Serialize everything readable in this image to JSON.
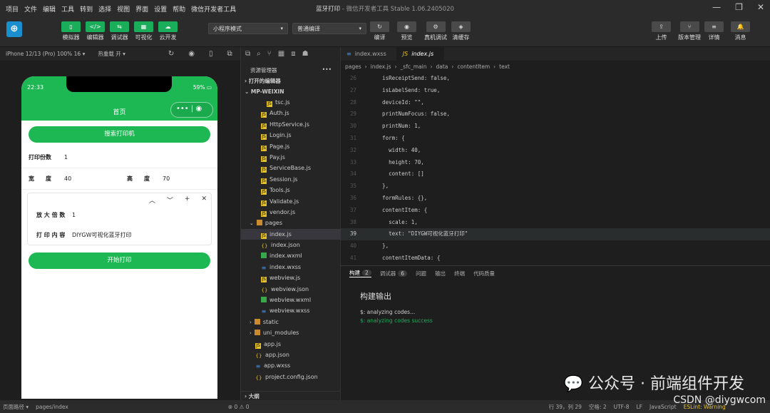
{
  "window": {
    "title": "蓝牙打印",
    "subtitle": "- 微信开发者工具 Stable 1.06.2405020",
    "menu": [
      "项目",
      "文件",
      "编辑",
      "工具",
      "转到",
      "选择",
      "视图",
      "界面",
      "设置",
      "帮助",
      "微信开发者工具"
    ]
  },
  "toolbar": {
    "left": [
      {
        "label": "模拟器",
        "glyph": "▯"
      },
      {
        "label": "编辑器",
        "glyph": "</>"
      },
      {
        "label": "调试器",
        "glyph": "⇆"
      },
      {
        "label": "可视化",
        "glyph": "▦"
      },
      {
        "label": "云开发",
        "glyph": "☁"
      }
    ],
    "mode": "小程序模式",
    "compile": "普通编译",
    "mid": [
      {
        "label": "编译",
        "glyph": "↻"
      },
      {
        "label": "预览",
        "glyph": "◉"
      },
      {
        "label": "真机调试",
        "glyph": "⚙"
      },
      {
        "label": "清缓存",
        "glyph": "◈"
      }
    ],
    "right": [
      {
        "label": "上传",
        "glyph": "⇪"
      },
      {
        "label": "版本管理",
        "glyph": "⑂"
      },
      {
        "label": "详情",
        "glyph": "≡"
      },
      {
        "label": "消息",
        "glyph": "🔔"
      }
    ]
  },
  "simbar": {
    "device": "iPhone 12/13 (Pro) 100% 16 ▾",
    "reload": "热重载 开 ▾"
  },
  "phone": {
    "time": "22:33",
    "battery": "59%",
    "title": "首页",
    "search_btn": "搜索打印机",
    "copies_label": "打印份数",
    "copies_value": "1",
    "width_label": "宽　　度",
    "width_value": "40",
    "height_label": "高　　度",
    "height_value": "70",
    "scale_label": "放 大 倍 数",
    "scale_value": "1",
    "content_label": "打 印 内 容",
    "content_value": "DIYGW可视化蓝牙打印",
    "start_btn": "开始打印"
  },
  "explorer": {
    "header": "资源管理器",
    "open_editors": "打开的编辑器",
    "project": "MP-WEIXIN",
    "outline": "大纲",
    "files": [
      {
        "name": "tsc.js",
        "type": "js",
        "indent": 36
      },
      {
        "name": "Auth.js",
        "type": "js",
        "indent": 28
      },
      {
        "name": "HttpService.js",
        "type": "js",
        "indent": 28
      },
      {
        "name": "Login.js",
        "type": "js",
        "indent": 28
      },
      {
        "name": "Page.js",
        "type": "js",
        "indent": 28
      },
      {
        "name": "Pay.js",
        "type": "js",
        "indent": 28
      },
      {
        "name": "ServiceBase.js",
        "type": "js",
        "indent": 28
      },
      {
        "name": "Session.js",
        "type": "js",
        "indent": 28
      },
      {
        "name": "Tools.js",
        "type": "js",
        "indent": 28
      },
      {
        "name": "Validate.js",
        "type": "js",
        "indent": 28
      },
      {
        "name": "vendor.js",
        "type": "js",
        "indent": 28
      },
      {
        "name": "pages",
        "type": "dir",
        "indent": 12
      },
      {
        "name": "index.js",
        "type": "js",
        "indent": 28,
        "active": true
      },
      {
        "name": "index.json",
        "type": "json",
        "indent": 28
      },
      {
        "name": "index.wxml",
        "type": "wxml",
        "indent": 28
      },
      {
        "name": "index.wxss",
        "type": "wxss",
        "indent": 28
      },
      {
        "name": "webview.js",
        "type": "js",
        "indent": 28
      },
      {
        "name": "webview.json",
        "type": "json",
        "indent": 28
      },
      {
        "name": "webview.wxml",
        "type": "wxml",
        "indent": 28
      },
      {
        "name": "webview.wxss",
        "type": "wxss",
        "indent": 28
      },
      {
        "name": "static",
        "type": "dir",
        "indent": 12
      },
      {
        "name": "uni_modules",
        "type": "dir",
        "indent": 12
      },
      {
        "name": "app.js",
        "type": "js",
        "indent": 20
      },
      {
        "name": "app.json",
        "type": "json",
        "indent": 20
      },
      {
        "name": "app.wxss",
        "type": "wxss",
        "indent": 20
      },
      {
        "name": "project.config.json",
        "type": "json",
        "indent": 20
      }
    ]
  },
  "editor": {
    "tabs": [
      "index.wxss",
      "index.js"
    ],
    "breadcrumb": [
      "pages",
      "index.js",
      "_sfc_main",
      "data",
      "contentItem",
      "text"
    ],
    "lines": [
      {
        "no": "26",
        "code": "    isReceiptSend: false,"
      },
      {
        "no": "27",
        "code": "    isLabelSend: true,"
      },
      {
        "no": "28",
        "code": "    deviceId: \"\","
      },
      {
        "no": "29",
        "code": "    printNumFocus: false,"
      },
      {
        "no": "30",
        "code": "    printNum: 1,"
      },
      {
        "no": "31",
        "code": "    form: {"
      },
      {
        "no": "32",
        "code": "      width: 40,"
      },
      {
        "no": "33",
        "code": "      height: 70,"
      },
      {
        "no": "34",
        "code": "      content: []"
      },
      {
        "no": "35",
        "code": "    },"
      },
      {
        "no": "36",
        "code": "    formRules: {},"
      },
      {
        "no": "37",
        "code": "    contentItem: {"
      },
      {
        "no": "38",
        "code": "      scale: 1,"
      },
      {
        "no": "39",
        "code": "      text: \"DIYGW可视化蓝牙打印\"",
        "cur": true
      },
      {
        "no": "40",
        "code": "    },"
      },
      {
        "no": "41",
        "code": "    contentItemData: {"
      }
    ]
  },
  "panel": {
    "tabs": [
      {
        "label": "构建",
        "badge": "2"
      },
      {
        "label": "调试器",
        "badge": "6"
      },
      {
        "label": "问题",
        "badge": ""
      },
      {
        "label": "输出",
        "badge": ""
      },
      {
        "label": "终端",
        "badge": ""
      },
      {
        "label": "代码质量",
        "badge": ""
      }
    ],
    "title": "构建输出",
    "line1": "$: analyzing codes...",
    "line2": "$: analyzing codes success"
  },
  "status": {
    "path": "页面路径 ▾",
    "page": "pages/index",
    "errors": "⊗ 0 ⚠ 0",
    "pos": "行 39，列 29",
    "spaces": "空格: 2",
    "enc": "UTF-8",
    "eol": "LF",
    "lang": "JavaScript",
    "lint": "ESLint: Warning"
  },
  "watermark": {
    "main": "公众号 · 前端组件开发",
    "sub": "CSDN @diygwcom"
  }
}
